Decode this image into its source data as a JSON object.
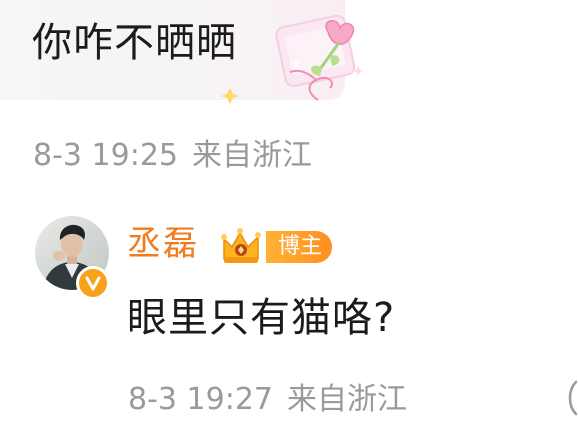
{
  "comment": {
    "text": "你咋不晒晒",
    "time": "8-3 19:25",
    "location": "来自浙江"
  },
  "reply": {
    "username": "丞磊",
    "badge": "博主",
    "text": "眼里只有猫咯?",
    "time": "8-3 19:27",
    "location": "来自浙江"
  },
  "colors": {
    "username": "#f27c1d",
    "meta": "#9a9a9a",
    "badge_bg": "#ff9a26",
    "verified_bg": "#f7a21a",
    "text": "#1b1b1b"
  },
  "icons": {
    "bubble_decoration": "tulip-gift-icon",
    "avatar": "user-avatar",
    "verified": "verified-v-icon",
    "crown": "crown-icon",
    "edge": "more-icon"
  }
}
